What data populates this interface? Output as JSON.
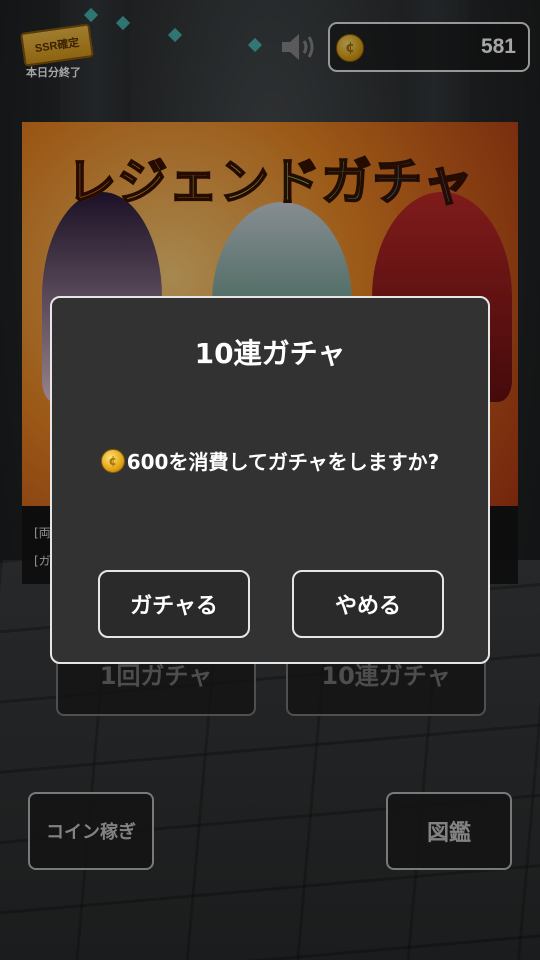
{
  "header": {
    "ssr_badge": "SSR確定",
    "ssr_sub": "本日分終了",
    "speaker_icon": "speaker-icon",
    "coins": "581"
  },
  "banner": {
    "title": "レジェンドガチャ",
    "line1": "[両",
    "line2": "[ガ"
  },
  "buttons": {
    "single_gacha": "1回ガチャ",
    "ten_gacha": "10連ガチャ",
    "earn_coins": "コイン稼ぎ",
    "zukan": "図鑑"
  },
  "dialog": {
    "title": "10連ガチャ",
    "message": "600を消費してガチャをしますか?",
    "confirm": "ガチャる",
    "cancel": "やめる"
  },
  "colors": {
    "dialog_bg": "#323232",
    "coin_gold": "#e2a514",
    "border": "#e6e6e6"
  }
}
